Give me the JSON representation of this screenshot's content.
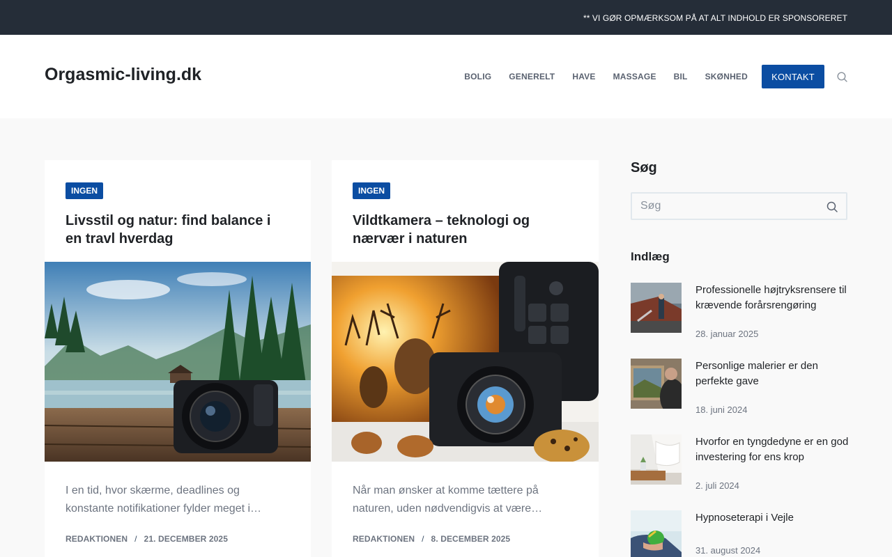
{
  "topbar": {
    "notice": "** VI GØR OPMÆRKSOM PÅ AT ALT INDHOLD ER SPONSORERET"
  },
  "header": {
    "site_title": "Orgasmic-living.dk",
    "nav": [
      "BOLIG",
      "GENERELT",
      "HAVE",
      "MASSAGE",
      "BIL",
      "SKØNHED"
    ],
    "cta": "KONTAKT"
  },
  "articles": [
    {
      "category": "INGEN",
      "title": "Livsstil og natur: find balance i en travl hverdag",
      "image": "camera-in-forest-landscape",
      "excerpt": "I en tid, hvor skærme, deadlines og konstante notifikationer fylder meget i…",
      "author": "REDAKTIONEN",
      "date": "21. DECEMBER 2025"
    },
    {
      "category": "INGEN",
      "title": "Vildtkamera – teknologi og nærvær i naturen",
      "image": "camera-with-deer-illustration",
      "excerpt": "Når man ønsker at komme tættere på naturen, uden nødvendigvis at være…",
      "author": "REDAKTIONEN",
      "date": "8. DECEMBER 2025"
    }
  ],
  "sidebar": {
    "search_title": "Søg",
    "search_placeholder": "Søg",
    "posts_title": "Indlæg",
    "posts": [
      {
        "title": "Professionelle højtryksrensere til krævende forårsrengøring",
        "date": "28. januar 2025",
        "thumb": "pressure-washer-boat"
      },
      {
        "title": "Personlige malerier er den perfekte gave",
        "date": "18. juni 2024",
        "thumb": "painting-artist"
      },
      {
        "title": "Hvorfor en tyngdedyne er en god investering for ens krop",
        "date": "2. juli 2024",
        "thumb": "weighted-blanket-bed"
      },
      {
        "title": "Hypnoseterapi i Vejle",
        "date": "31. august 2024",
        "thumb": "stress-ball-hand"
      }
    ]
  },
  "colors": {
    "accent": "#0b4da2",
    "topbar": "#252d38",
    "background": "#f9f9f9"
  }
}
